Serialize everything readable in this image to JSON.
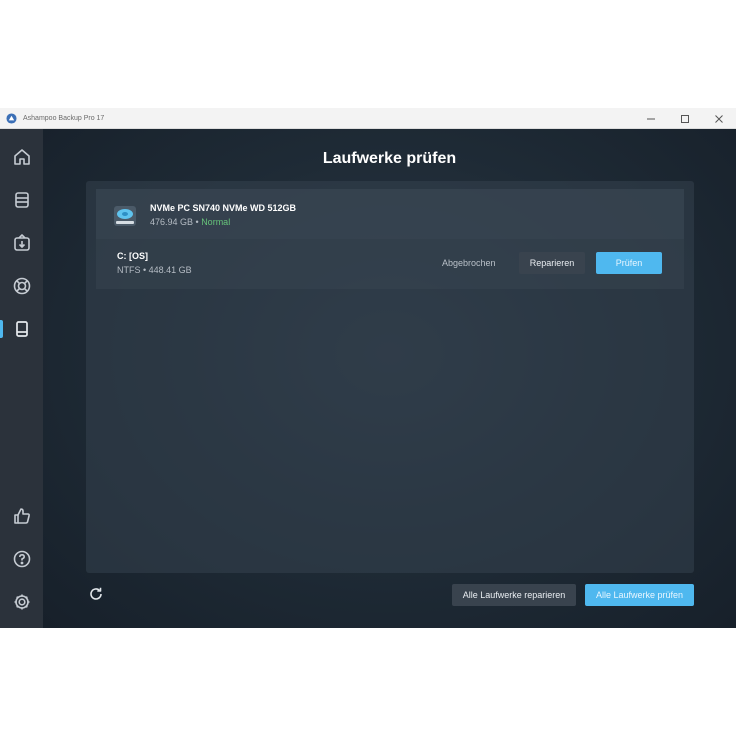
{
  "window": {
    "title": "Ashampoo Backup Pro 17"
  },
  "main": {
    "title": "Laufwerke prüfen",
    "drive": {
      "name": "NVMe PC SN740 NVMe WD 512GB",
      "size": "476.94 GB",
      "separator": " • ",
      "status": "Normal",
      "icon": "hard-drive-icon"
    },
    "partition": {
      "name": "C: [OS]",
      "details": "NTFS • 448.41 GB",
      "status": "Abgebrochen",
      "repair_label": "Reparieren",
      "check_label": "Prüfen"
    },
    "footer": {
      "repair_all_label": "Alle Laufwerke reparieren",
      "check_all_label": "Alle Laufwerke prüfen",
      "refresh_icon": "refresh-icon"
    }
  },
  "sidebar": {
    "items": [
      {
        "icon": "home-icon",
        "active": false
      },
      {
        "icon": "backups-icon",
        "active": false
      },
      {
        "icon": "restore-icon",
        "active": false
      },
      {
        "icon": "help-ring-icon",
        "active": false
      },
      {
        "icon": "drive-check-icon",
        "active": true
      },
      {
        "icon": "thumbs-up-icon",
        "active": false
      },
      {
        "icon": "question-icon",
        "active": false
      },
      {
        "icon": "settings-icon",
        "active": false
      }
    ]
  },
  "colors": {
    "accent": "#4fb8ef",
    "status_ok": "#66c47a",
    "sidebar": "#2b323b",
    "background": "#1e2a35"
  }
}
